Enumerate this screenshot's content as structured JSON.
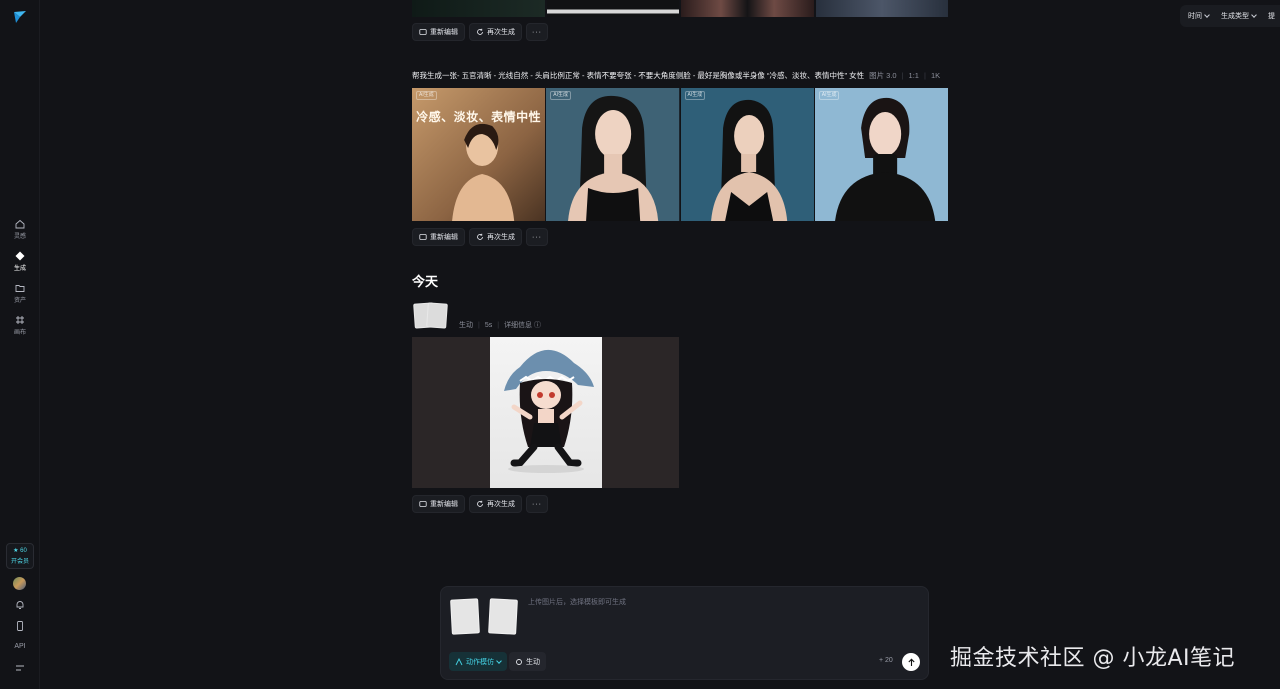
{
  "nav": {
    "items": [
      {
        "label": "灵感",
        "icon": "home-icon"
      },
      {
        "label": "生成",
        "icon": "diamond-icon"
      },
      {
        "label": "资产",
        "icon": "folder-icon"
      },
      {
        "label": "画布",
        "icon": "canvas-icon"
      }
    ],
    "vip_points": "★ 60",
    "vip_label": "开会员",
    "api_label": "API"
  },
  "top_filters": {
    "time": "时间",
    "type": "生成类型",
    "extra": "提"
  },
  "actions": {
    "re_edit": "重新编辑",
    "regenerate": "再次生成",
    "more": "···"
  },
  "prompt_group": {
    "text": "帮我生成一张- 五官清晰 - 光线自然 - 头肩比例正常 - 表情不要夸张 - 不要大角度侧脸 - 最好是胸像或半身像 “冷感、淡妆、表情中性” 女性",
    "model": "图片 3.0",
    "ratio": "1:1",
    "resolution": "1K",
    "ai_tag": "AI生成",
    "poster_title": "冷感、淡妆、表情中性"
  },
  "today": {
    "title": "今天",
    "mode": "生动",
    "duration": "5s",
    "details": "详细信息 ⓘ"
  },
  "composer": {
    "placeholder": "上传图片后，选择模板即可生成",
    "mode_button": "动作模仿",
    "generate_button": "生动",
    "credits": "+ 20"
  },
  "watermark": "掘金技术社区 @ 小龙AI笔记",
  "colors": {
    "background": "#121317",
    "accent": "#45d4e6",
    "panel": "#1c1e24"
  }
}
